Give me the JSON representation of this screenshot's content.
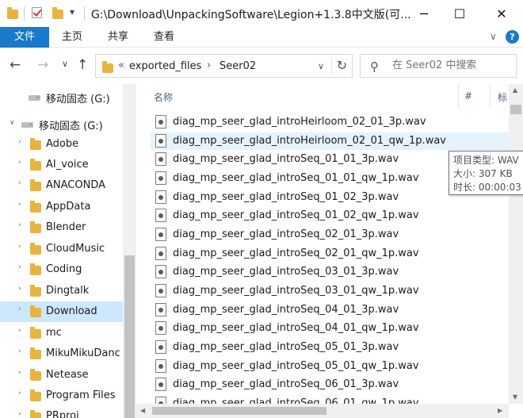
{
  "titlebar": {
    "path": "G:\\Download\\UnpackingSoftware\\Legion+1.3.8中文版(可...",
    "minimize_glyph": "─",
    "maximize_glyph": "☐",
    "close_glyph": "✕",
    "dropdown_glyph": "▾"
  },
  "ribbon": {
    "tabs": [
      "文件",
      "主页",
      "共享",
      "查看"
    ],
    "collapse_glyph": "∨",
    "help_glyph": "?"
  },
  "nav": {
    "back_glyph": "←",
    "forward_glyph": "→",
    "recent_glyph": "∨",
    "up_glyph": "↑",
    "overflow": "«",
    "crumbs": [
      "exported_files",
      "Seer02"
    ],
    "crumb_sep": "›",
    "history_glyph": "∨",
    "refresh_glyph": "↻"
  },
  "search": {
    "placeholder": "在 Seer02 中搜索",
    "icon_glyph": "⚲"
  },
  "sidebar": {
    "items": [
      {
        "label": "移动固态 (G:)",
        "kind": "drive"
      },
      {
        "label": "移动固态 (G:)",
        "kind": "drive",
        "expanded": true
      },
      {
        "label": "Adobe",
        "kind": "folder"
      },
      {
        "label": "AI_voice",
        "kind": "folder"
      },
      {
        "label": "ANACONDA",
        "kind": "folder"
      },
      {
        "label": "AppData",
        "kind": "folder"
      },
      {
        "label": "Blender",
        "kind": "folder"
      },
      {
        "label": "CloudMusic",
        "kind": "folder"
      },
      {
        "label": "Coding",
        "kind": "folder"
      },
      {
        "label": "Dingtalk",
        "kind": "folder"
      },
      {
        "label": "Download",
        "kind": "folder",
        "selected": true
      },
      {
        "label": "mc",
        "kind": "folder"
      },
      {
        "label": "MikuMikuDanc",
        "kind": "folder"
      },
      {
        "label": "Netease",
        "kind": "folder"
      },
      {
        "label": "Program Files",
        "kind": "folder"
      },
      {
        "label": "PRproj",
        "kind": "folder"
      }
    ],
    "collapsed_glyph": "›",
    "expanded_glyph": "∨"
  },
  "filelist": {
    "columns": [
      "名称",
      "#",
      "标"
    ],
    "sort_glyph": "^",
    "files": [
      "diag_mp_seer_glad_introHeirloom_02_01_3p.wav",
      "diag_mp_seer_glad_introHeirloom_02_01_qw_1p.wav",
      "diag_mp_seer_glad_introSeq_01_01_3p.wav",
      "diag_mp_seer_glad_introSeq_01_01_qw_1p.wav",
      "diag_mp_seer_glad_introSeq_01_02_3p.wav",
      "diag_mp_seer_glad_introSeq_01_02_qw_1p.wav",
      "diag_mp_seer_glad_introSeq_02_01_3p.wav",
      "diag_mp_seer_glad_introSeq_02_01_qw_1p.wav",
      "diag_mp_seer_glad_introSeq_03_01_3p.wav",
      "diag_mp_seer_glad_introSeq_03_01_qw_1p.wav",
      "diag_mp_seer_glad_introSeq_04_01_3p.wav",
      "diag_mp_seer_glad_introSeq_04_01_qw_1p.wav",
      "diag_mp_seer_glad_introSeq_05_01_3p.wav",
      "diag_mp_seer_glad_introSeq_05_01_qw_1p.wav",
      "diag_mp_seer_glad_introSeq_06_01_3p.wav"
    ],
    "partial_last": "diag_mp_seer_glad_introSeq_06_01_qw_1p.wav",
    "hovered_index": 1
  },
  "tooltip": {
    "type_line": "项目类型: WAV",
    "size_line": "大小: 307 KB",
    "duration_line": "时长: 00:00:03"
  },
  "colors": {
    "accent": "#1979ca",
    "selection": "#cce8ff",
    "hover": "#e5f3ff",
    "folder": "#e8b43c"
  }
}
